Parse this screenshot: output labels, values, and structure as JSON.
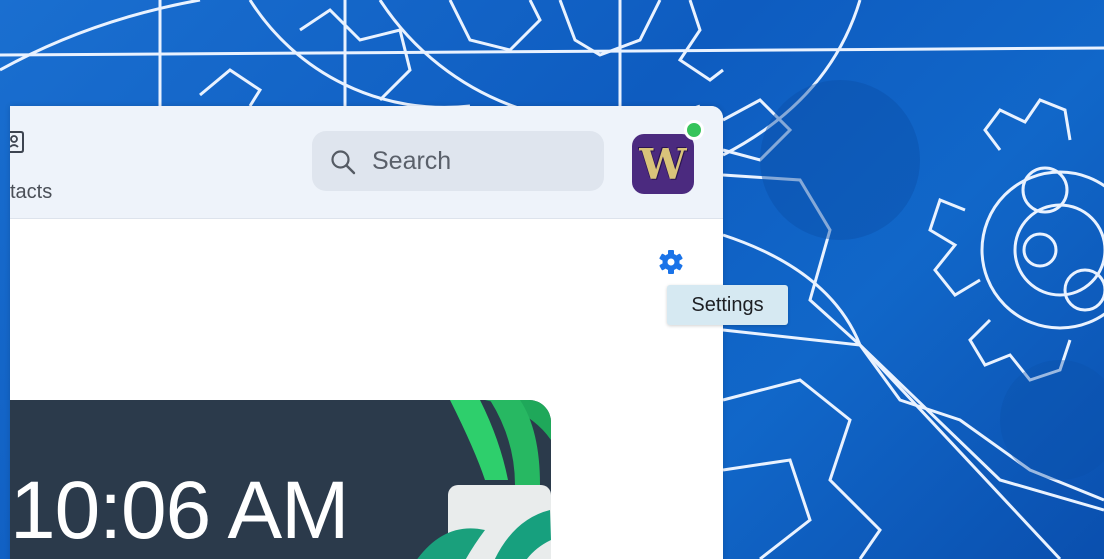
{
  "toolbar": {
    "contacts_label": "tacts",
    "search_placeholder": "Search",
    "avatar_letter": "W"
  },
  "settings": {
    "icon": "gear-icon",
    "tooltip": "Settings"
  },
  "clock_card": {
    "time": "10:06 AM"
  },
  "colors": {
    "accent": "#1a73e8",
    "status_online": "#37c45a",
    "avatar_bg": "#4b2a7f",
    "avatar_letter": "#d9c37a",
    "wallpaper": "#1167c9",
    "card_bg": "#2b3a4b"
  }
}
